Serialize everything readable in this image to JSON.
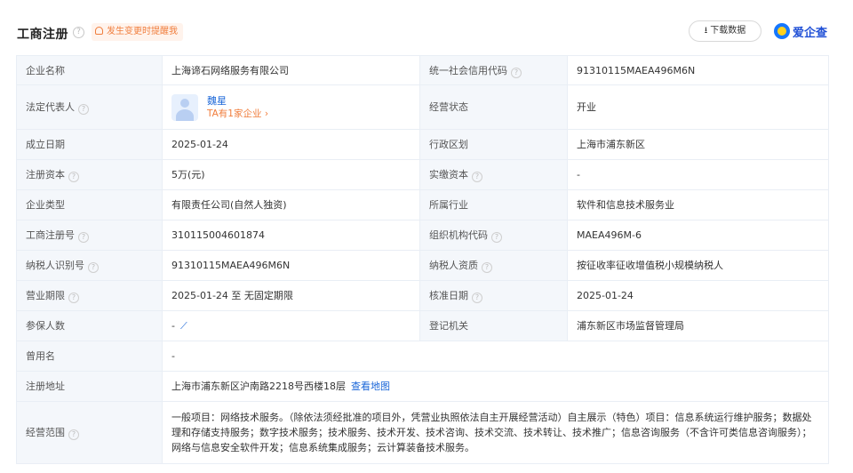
{
  "header": {
    "title": "工商注册",
    "remind_label": "发生变更时提醒我",
    "download_label": "下载数据",
    "logo_text": "爱企查",
    "brand_color": "#1677ff",
    "accent_color": "#f07d3c"
  },
  "rows": [
    {
      "l1": "企业名称",
      "v1": "上海谛石网络服务有限公司",
      "l2": "统一社会信用代码",
      "v2": "91310115MAEA496M6N"
    },
    {
      "l1": "法定代表人",
      "person_name": "魏星",
      "person_sub": "TA有1家企业",
      "l2": "经营状态",
      "v2": "开业"
    },
    {
      "l1": "成立日期",
      "v1": "2025-01-24",
      "l2": "行政区划",
      "v2": "上海市浦东新区"
    },
    {
      "l1": "注册资本",
      "v1": "5万(元)",
      "l2": "实缴资本",
      "v2": "-"
    },
    {
      "l1": "企业类型",
      "v1": "有限责任公司(自然人独资)",
      "l2": "所属行业",
      "v2": "软件和信息技术服务业"
    },
    {
      "l1": "工商注册号",
      "v1": "310115004601874",
      "l2": "组织机构代码",
      "v2": "MAEA496M-6"
    },
    {
      "l1": "纳税人识别号",
      "v1": "91310115MAEA496M6N",
      "l2": "纳税人资质",
      "v2": "按征收率征收增值税小规模纳税人"
    },
    {
      "l1": "营业期限",
      "v1": "2025-01-24 至 无固定期限",
      "l2": "核准日期",
      "v2": "2025-01-24"
    },
    {
      "l1": "参保人数",
      "v1": "-",
      "l2": "登记机关",
      "v2": "浦东新区市场监督管理局"
    },
    {
      "l1": "曾用名",
      "v1": "-"
    },
    {
      "l1": "注册地址",
      "v1": "上海市浦东新区沪南路2218号西楼18层",
      "link": "查看地图"
    },
    {
      "l1": "经营范围",
      "v1": "一般项目：网络技术服务。（除依法须经批准的项目外，凭营业执照依法自主开展经营活动）自主展示（特色）项目：信息系统运行维护服务；数据处理和存储支持服务；数字技术服务；技术服务、技术开发、技术咨询、技术交流、技术转让、技术推广；信息咨询服务（不含许可类信息咨询服务）；网络与信息安全软件开发；信息系统集成服务；云计算装备技术服务。"
    }
  ]
}
